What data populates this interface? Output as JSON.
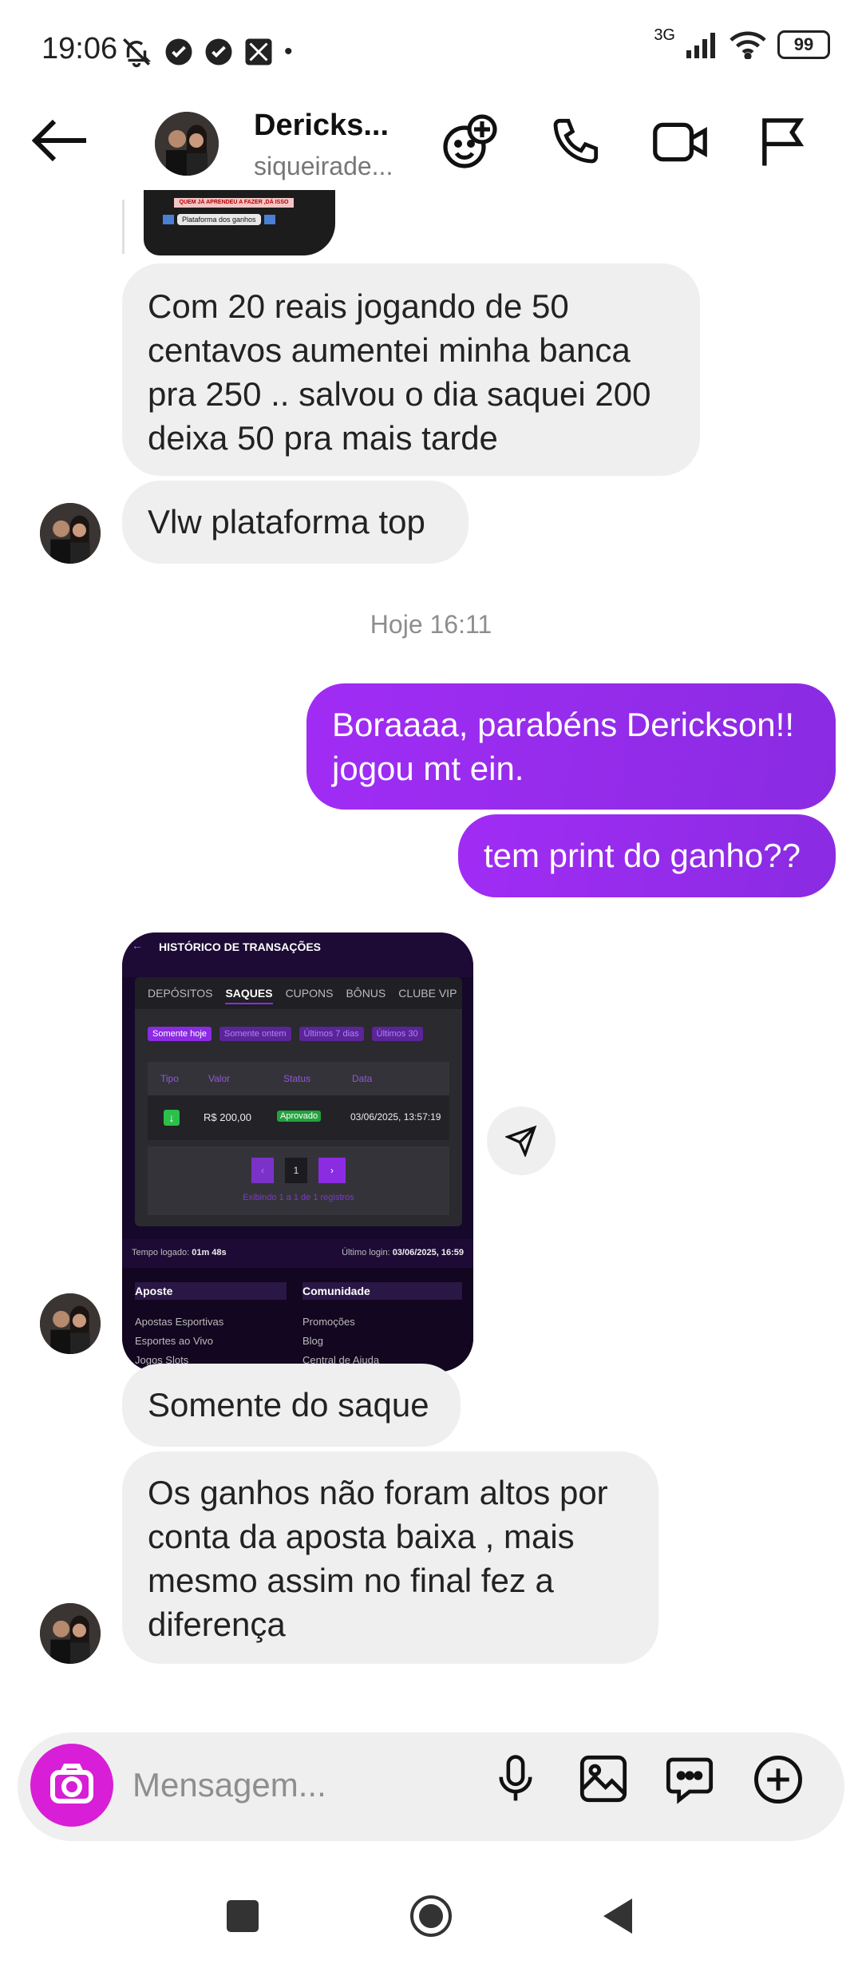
{
  "status_bar": {
    "time": "19:06",
    "network": "3G",
    "battery": "99"
  },
  "header": {
    "name": "Dericks...",
    "username": "siqueirade..."
  },
  "top_thumbnail": {
    "headline": "QUEM JÁ APRENDEU A FAZER ,DÁ ISSO",
    "button": "Plataforma dos ganhos"
  },
  "messages": {
    "m1": [
      "Com 20 reais jogando de 50",
      "centavos aumentei minha banca",
      "pra 250 .. salvou o dia saquei 200",
      "deixa 50 pra mais tarde"
    ],
    "m2": "Vlw plataforma top",
    "timestamp": "Hoje 16:11",
    "s1": [
      "Boraaaa, parabéns Derickson!!",
      "jogou mt ein."
    ],
    "s2": "tem print do ganho??",
    "m3": "Somente do saque",
    "m4": [
      "Os ganhos não foram altos por",
      "conta da aposta baixa  , mais",
      "mesmo assim no final fez a",
      "diferença"
    ]
  },
  "transaction_shot": {
    "title": "HISTÓRICO DE TRANSAÇÕES",
    "tabs": [
      "DEPÓSITOS",
      "SAQUES",
      "CUPONS",
      "BÔNUS",
      "CLUBE VIP"
    ],
    "filters": [
      "Somente hoje",
      "Somente ontem",
      "Últimos 7 dias",
      "Últimos 30"
    ],
    "columns": [
      "Tipo",
      "Valor",
      "Status",
      "Data"
    ],
    "row": {
      "valor": "R$ 200,00",
      "status": "Aprovado",
      "data": "03/06/2025, 13:57:19"
    },
    "page": "1",
    "showing": "Exibindo 1 a 1 de 1 registros",
    "tempo_label": "Tempo logado:",
    "tempo_value": "01m 48s",
    "login_label": "Último login:",
    "login_value": "03/06/2025, 16:59",
    "col1_title": "Aposte",
    "col1_items": [
      "Apostas Esportivas",
      "Esportes ao Vivo",
      "Jogos Slots"
    ],
    "col2_title": "Comunidade",
    "col2_items": [
      "Promoções",
      "Blog",
      "Central de Ajuda"
    ]
  },
  "input": {
    "placeholder": "Mensagem..."
  },
  "colors": {
    "sent_bubble": "#9b30ef",
    "camera": "#d81ed6",
    "received_bubble": "#efefef"
  },
  "icons": [
    "back-arrow-icon",
    "sticker-add-icon",
    "phone-icon",
    "video-camera-icon",
    "flag-icon",
    "share-icon",
    "camera-icon",
    "microphone-icon",
    "gallery-icon",
    "chat-bubble-icon",
    "plus-circle-icon"
  ]
}
